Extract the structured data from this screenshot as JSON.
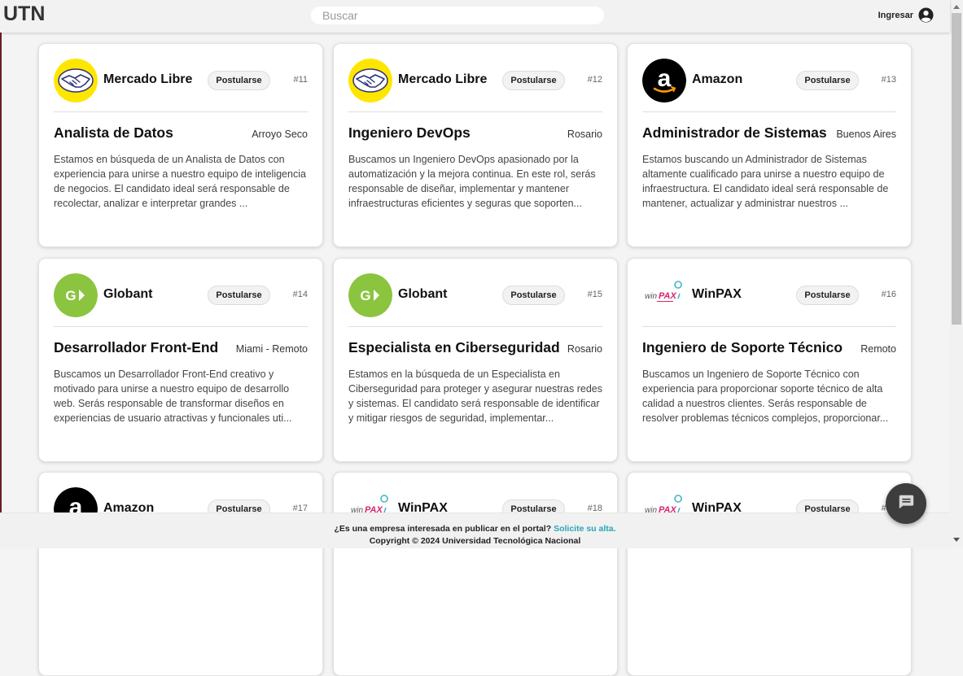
{
  "header": {
    "logo": "UTN",
    "search_placeholder": "Buscar",
    "login_label": "Ingresar"
  },
  "apply_label": "Postularse",
  "jobs": [
    {
      "company": "Mercado Libre",
      "logo": "mercadolibre",
      "number": "#11",
      "title": "Analista de Datos",
      "location": "Arroyo Seco",
      "description": "Estamos en búsqueda de un Analista de Datos con experiencia para unirse a nuestro equipo de inteligencia de negocios. El candidato ideal será responsable de recolectar, analizar e interpretar grandes ..."
    },
    {
      "company": "Mercado Libre",
      "logo": "mercadolibre",
      "number": "#12",
      "title": "Ingeniero DevOps",
      "location": "Rosario",
      "description": "Buscamos un Ingeniero DevOps apasionado por la automatización y la mejora continua. En este rol, serás responsable de diseñar, implementar y mantener infraestructuras eficientes y seguras que soporten..."
    },
    {
      "company": "Amazon",
      "logo": "amazon",
      "number": "#13",
      "title": "Administrador de Sistemas",
      "location": "Buenos Aires",
      "description": "Estamos buscando un Administrador de Sistemas altamente cualificado para unirse a nuestro equipo de infraestructura. El candidato ideal será responsable de mantener, actualizar y administrar nuestros ..."
    },
    {
      "company": "Globant",
      "logo": "globant",
      "number": "#14",
      "title": "Desarrollador Front-End",
      "location": "Miami - Remoto",
      "description": "Buscamos un Desarrollador Front-End creativo y motivado para unirse a nuestro equipo de desarrollo web. Serás responsable de transformar diseños en experiencias de usuario atractivas y funcionales uti..."
    },
    {
      "company": "Globant",
      "logo": "globant",
      "number": "#15",
      "title": "Especialista en Ciberseguridad",
      "location": "Rosario",
      "description": "Estamos en la búsqueda de un Especialista en Ciberseguridad para proteger y asegurar nuestras redes y sistemas. El candidato será responsable de identificar y mitigar riesgos de seguridad, implementar..."
    },
    {
      "company": "WinPAX",
      "logo": "winpax",
      "number": "#16",
      "title": "Ingeniero de Soporte Técnico",
      "location": "Remoto",
      "description": "Buscamos un Ingeniero de Soporte Técnico con experiencia para proporcionar soporte técnico de alta calidad a nuestros clientes. Serás responsable de resolver problemas técnicos complejos, proporcionar..."
    },
    {
      "company": "Amazon",
      "logo": "amazon",
      "number": "#17",
      "title": "",
      "location": "",
      "description": ""
    },
    {
      "company": "WinPAX",
      "logo": "winpax",
      "number": "#18",
      "title": "",
      "location": "",
      "description": ""
    },
    {
      "company": "WinPAX",
      "logo": "winpax",
      "number": "#19",
      "title": "",
      "location": "",
      "description": ""
    }
  ],
  "footer": {
    "question": "¿Es una empresa interesada en publicar en el portal?",
    "link": "Solicite su alta.",
    "copyright": "Copyright © 2024 Universidad Tecnológica Nacional"
  },
  "colors": {
    "accent_link": "#29a6b8",
    "mercadolibre_yellow": "#ffe600",
    "globant_green": "#8bc43f"
  }
}
